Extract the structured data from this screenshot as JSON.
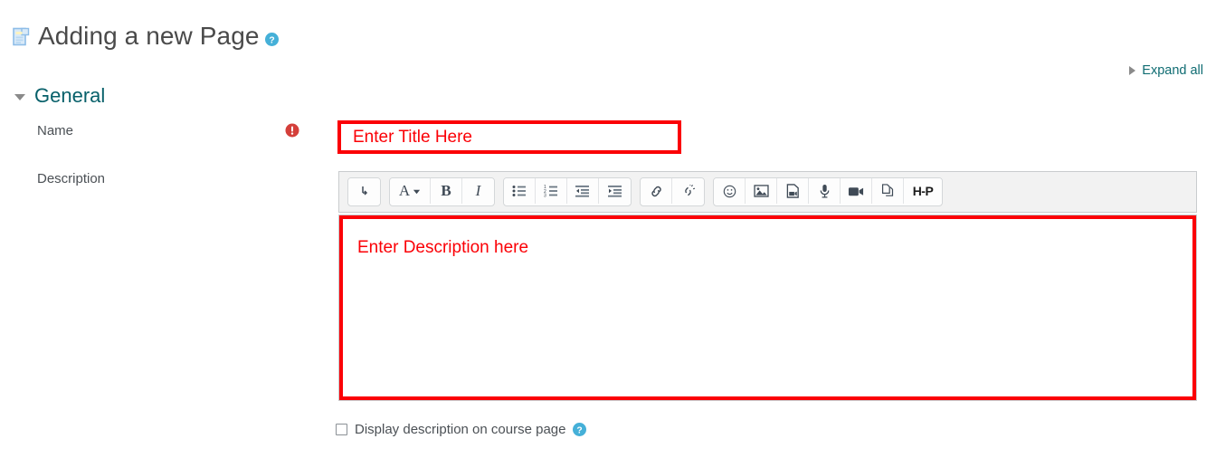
{
  "header": {
    "icon": "page-document-icon",
    "title": "Adding a new Page",
    "help_icon": "help-circle-icon"
  },
  "expand_all": {
    "label": "Expand all",
    "toggle_icon": "triangle-right-icon"
  },
  "section": {
    "title": "General",
    "toggle_icon": "triangle-down-icon",
    "expanded": true
  },
  "fields": {
    "name": {
      "label": "Name",
      "required_icon": "required-exclamation-icon",
      "value": "Enter Title Here",
      "placeholder": "Enter Title Here",
      "annotation_color": "#fb0006"
    },
    "description": {
      "label": "Description",
      "value": "Enter Description here",
      "annotation_color": "#fb0006"
    },
    "display_description": {
      "label": "Display description on course page",
      "checked": false,
      "help_icon": "help-circle-icon"
    }
  },
  "editor": {
    "toolbar_groups": [
      {
        "name": "expand-group",
        "buttons": [
          {
            "name": "show-more-button",
            "icon": "arrow-down-turn-icon",
            "label": ""
          }
        ]
      },
      {
        "name": "format-group",
        "buttons": [
          {
            "name": "style-dropdown-button",
            "icon": "font-style-dropdown-icon",
            "label": "A"
          },
          {
            "name": "bold-button",
            "icon": "bold-icon",
            "label": "B"
          },
          {
            "name": "italic-button",
            "icon": "italic-icon",
            "label": "I"
          }
        ]
      },
      {
        "name": "list-group",
        "buttons": [
          {
            "name": "bullet-list-button",
            "icon": "bullet-list-icon",
            "label": ""
          },
          {
            "name": "numbered-list-button",
            "icon": "numbered-list-icon",
            "label": ""
          },
          {
            "name": "outdent-button",
            "icon": "outdent-icon",
            "label": ""
          },
          {
            "name": "indent-button",
            "icon": "indent-icon",
            "label": ""
          }
        ]
      },
      {
        "name": "link-group",
        "buttons": [
          {
            "name": "link-button",
            "icon": "link-icon",
            "label": ""
          },
          {
            "name": "unlink-button",
            "icon": "unlink-icon",
            "label": ""
          }
        ]
      },
      {
        "name": "media-group",
        "buttons": [
          {
            "name": "emoji-button",
            "icon": "smiley-icon",
            "label": ""
          },
          {
            "name": "insert-image-button",
            "icon": "image-icon",
            "label": ""
          },
          {
            "name": "insert-media-button",
            "icon": "media-file-icon",
            "label": ""
          },
          {
            "name": "record-audio-button",
            "icon": "microphone-icon",
            "label": ""
          },
          {
            "name": "record-video-button",
            "icon": "video-camera-icon",
            "label": ""
          },
          {
            "name": "manage-files-button",
            "icon": "copy-files-icon",
            "label": ""
          },
          {
            "name": "h5p-button",
            "icon": "h5p-icon",
            "label": "H-P"
          }
        ]
      }
    ]
  },
  "colors": {
    "annotation_red": "#fb0006",
    "section_teal": "#07606a",
    "link_teal": "#0f6c72",
    "help_blue": "#45b0d8",
    "required_red": "#d43f3a"
  }
}
